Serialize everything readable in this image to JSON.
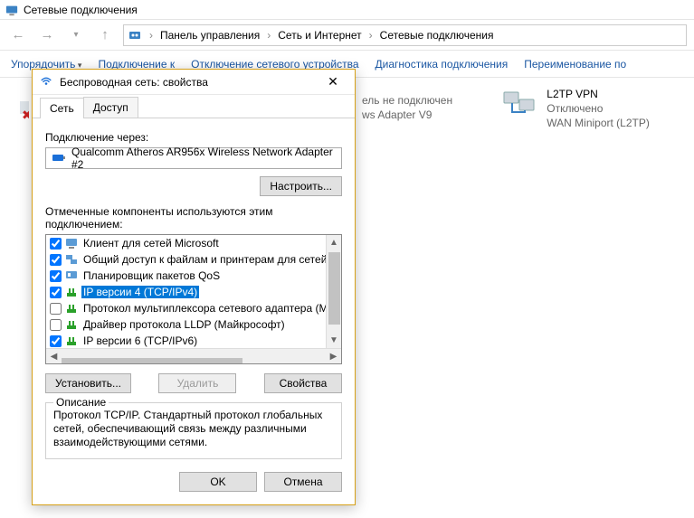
{
  "explorer": {
    "title": "Сетевые подключения",
    "breadcrumbs": [
      "Панель управления",
      "Сеть и Интернет",
      "Сетевые подключения"
    ],
    "toolbar": {
      "organize": "Упорядочить",
      "connect": "Подключение к",
      "disable_device": "Отключение сетевого устройства",
      "diagnose": "Диагностика подключения",
      "rename": "Переименование по"
    }
  },
  "behind": {
    "line1": "ель не подключен",
    "line2": "ws Adapter V9"
  },
  "vpn": {
    "name": "L2TP VPN",
    "status": "Отключено",
    "device": "WAN Miniport (L2TP)"
  },
  "dialog": {
    "title": "Беспроводная сеть: свойства",
    "tabs": {
      "network": "Сеть",
      "access": "Доступ"
    },
    "connect_using_label": "Подключение через:",
    "adapter": "Qualcomm Atheros AR956x Wireless Network Adapter #2",
    "configure_btn": "Настроить...",
    "components_label": "Отмеченные компоненты используются этим подключением:",
    "components": [
      {
        "checked": true,
        "icon": "client",
        "label": "Клиент для сетей Microsoft"
      },
      {
        "checked": true,
        "icon": "share",
        "label": "Общий доступ к файлам и принтерам для сетей Mi"
      },
      {
        "checked": true,
        "icon": "qos",
        "label": "Планировщик пакетов QoS"
      },
      {
        "checked": true,
        "icon": "protocol",
        "label": "IP версии 4 (TCP/IPv4)",
        "selected": true
      },
      {
        "checked": false,
        "icon": "protocol",
        "label": "Протокол мультиплексора сетевого адаптера (Ма"
      },
      {
        "checked": false,
        "icon": "protocol",
        "label": "Драйвер протокола LLDP (Майкрософт)"
      },
      {
        "checked": true,
        "icon": "protocol",
        "label": "IP версии 6 (TCP/IPv6)"
      }
    ],
    "buttons": {
      "install": "Установить...",
      "remove": "Удалить",
      "properties": "Свойства"
    },
    "description": {
      "legend": "Описание",
      "text": "Протокол TCP/IP. Стандартный протокол глобальных сетей, обеспечивающий связь между различными взаимодействующими сетями."
    },
    "footer": {
      "ok": "OK",
      "cancel": "Отмена"
    }
  }
}
